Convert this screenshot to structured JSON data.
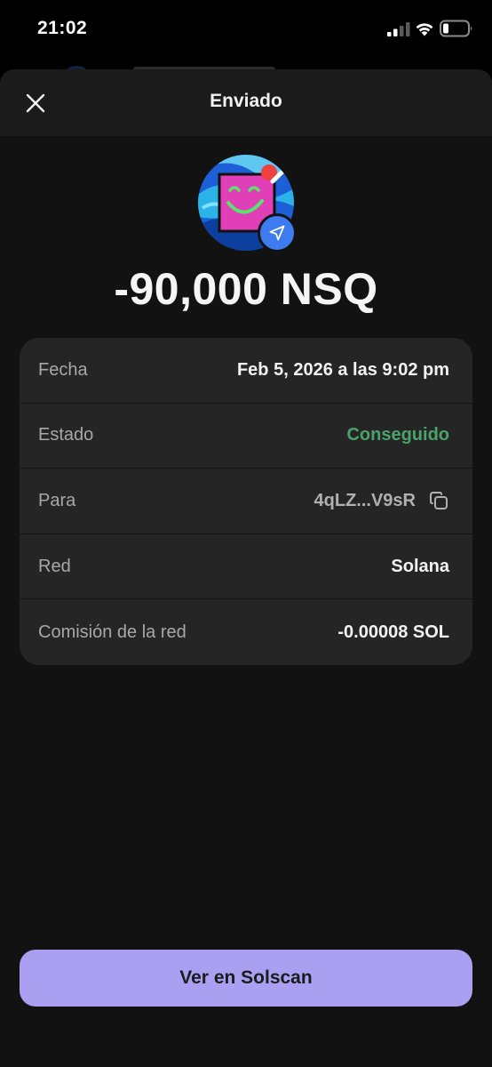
{
  "status_bar": {
    "time": "21:02",
    "icons": [
      "signal-icon",
      "wifi-icon",
      "battery-icon"
    ]
  },
  "header": {
    "title": "Enviado",
    "close_icon": "close-icon"
  },
  "token": {
    "avatar_icon": "token-avatar-icon",
    "badge_icon": "send-icon",
    "amount": "-90,000 NSQ"
  },
  "details": {
    "rows": [
      {
        "label": "Fecha",
        "value": "Feb 5, 2026 a las 9:02 pm"
      },
      {
        "label": "Estado",
        "value": "Conseguido"
      },
      {
        "label": "Para",
        "value": "4qLZ...V9sR"
      },
      {
        "label": "Red",
        "value": "Solana"
      },
      {
        "label": "Comisión de la red",
        "value": "-0.00008 SOL"
      }
    ]
  },
  "actions": {
    "solscan_label": "Ver en Solscan"
  },
  "colors": {
    "sheet_bg": "#121212",
    "card_bg": "#252525",
    "success": "#4aa36a",
    "accent_button": "#ab9ff2",
    "badge_blue": "#3d7bf0"
  }
}
